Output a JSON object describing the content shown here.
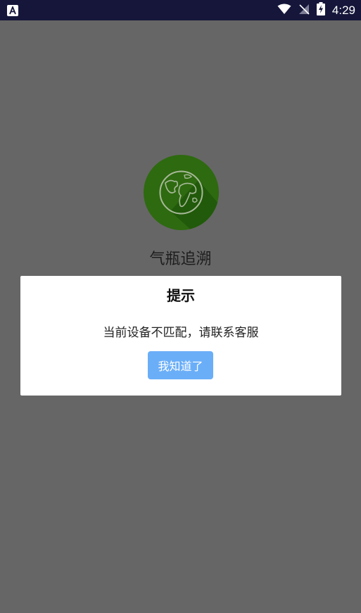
{
  "status_bar": {
    "time": "4:29",
    "icons": [
      "app-notification-icon",
      "wifi-icon",
      "no-signal-icon",
      "battery-charging-icon"
    ]
  },
  "splash": {
    "app_name": "气瓶追溯",
    "logo_icon": "globe-icon"
  },
  "dialog": {
    "title": "提示",
    "message": "当前设备不匹配，请联系客服",
    "confirm_label": "我知道了"
  },
  "colors": {
    "overlay": "#666666",
    "status_bar": "#15163a",
    "logo_bg": "#2e6a10",
    "button_bg": "#6aaef8",
    "dialog_bg": "#ffffff"
  }
}
